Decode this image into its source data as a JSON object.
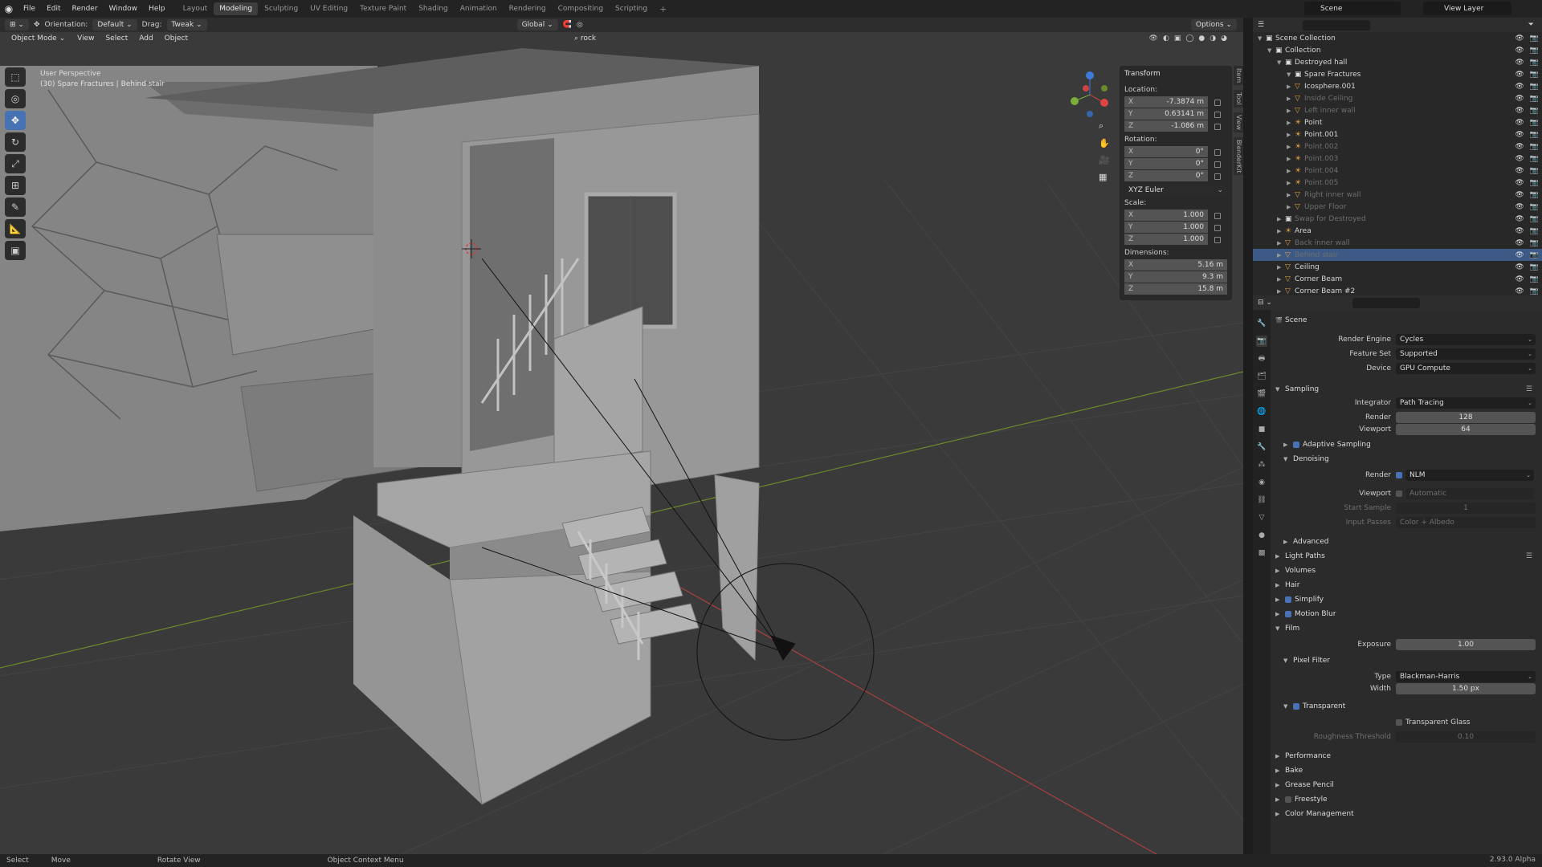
{
  "topbar": {
    "menus": [
      "File",
      "Edit",
      "Render",
      "Window",
      "Help"
    ],
    "workspaces": [
      "Layout",
      "Modeling",
      "Sculpting",
      "UV Editing",
      "Texture Paint",
      "Shading",
      "Animation",
      "Rendering",
      "Compositing",
      "Scripting"
    ],
    "active_workspace": "Modeling",
    "scene": "Scene",
    "view_layer": "View Layer"
  },
  "viewport_header": {
    "orientation_label": "Orientation:",
    "orientation_value": "Default",
    "drag_label": "Drag:",
    "drag_value": "Tweak",
    "transform_space": "Global",
    "search_value": "rock",
    "options_label": "Options"
  },
  "viewport_header2": {
    "mode": "Object Mode",
    "menus": [
      "View",
      "Select",
      "Add",
      "Object"
    ]
  },
  "viewport_info": {
    "line1": "User Perspective",
    "line2": "(30) Spare Fractures | Behind stair"
  },
  "npanel": {
    "title": "Transform",
    "location_label": "Location:",
    "location": {
      "x": "-7.3874 m",
      "y": "0.63141 m",
      "z": "-1.086 m"
    },
    "rotation_label": "Rotation:",
    "rotation": {
      "x": "0°",
      "y": "0°",
      "z": "0°"
    },
    "rotation_mode": "XYZ Euler",
    "scale_label": "Scale:",
    "scale": {
      "x": "1.000",
      "y": "1.000",
      "z": "1.000"
    },
    "dimensions_label": "Dimensions:",
    "dimensions": {
      "x": "5.16 m",
      "y": "9.3 m",
      "z": "15.8 m"
    },
    "tabs": [
      "Item",
      "Tool",
      "View",
      "BlenderKit"
    ]
  },
  "outliner": {
    "rows": [
      {
        "label": "Scene Collection",
        "indent": 0,
        "dim": false,
        "sel": false,
        "type": "coll"
      },
      {
        "label": "Collection",
        "indent": 1,
        "dim": false,
        "sel": false,
        "type": "coll"
      },
      {
        "label": "Destroyed hall",
        "indent": 2,
        "dim": false,
        "sel": false,
        "type": "coll"
      },
      {
        "label": "Spare Fractures",
        "indent": 3,
        "dim": false,
        "sel": false,
        "type": "coll"
      },
      {
        "label": "Icosphere.001",
        "indent": 3,
        "dim": false,
        "sel": false,
        "type": "mesh"
      },
      {
        "label": "Inside Ceiling",
        "indent": 3,
        "dim": true,
        "sel": false,
        "type": "mesh"
      },
      {
        "label": "Left inner wall",
        "indent": 3,
        "dim": true,
        "sel": false,
        "type": "mesh"
      },
      {
        "label": "Point",
        "indent": 3,
        "dim": false,
        "sel": false,
        "type": "light"
      },
      {
        "label": "Point.001",
        "indent": 3,
        "dim": false,
        "sel": false,
        "type": "light"
      },
      {
        "label": "Point.002",
        "indent": 3,
        "dim": true,
        "sel": false,
        "type": "light"
      },
      {
        "label": "Point.003",
        "indent": 3,
        "dim": true,
        "sel": false,
        "type": "light"
      },
      {
        "label": "Point.004",
        "indent": 3,
        "dim": true,
        "sel": false,
        "type": "light"
      },
      {
        "label": "Point.005",
        "indent": 3,
        "dim": true,
        "sel": false,
        "type": "light"
      },
      {
        "label": "Right inner wall",
        "indent": 3,
        "dim": true,
        "sel": false,
        "type": "mesh"
      },
      {
        "label": "Upper Floor",
        "indent": 3,
        "dim": true,
        "sel": false,
        "type": "mesh"
      },
      {
        "label": "Swap for Destroyed",
        "indent": 2,
        "dim": true,
        "sel": false,
        "type": "coll"
      },
      {
        "label": "Area",
        "indent": 2,
        "dim": false,
        "sel": false,
        "type": "light"
      },
      {
        "label": "Back inner wall",
        "indent": 2,
        "dim": true,
        "sel": false,
        "type": "mesh"
      },
      {
        "label": "Behind stair",
        "indent": 2,
        "dim": true,
        "sel": true,
        "type": "mesh"
      },
      {
        "label": "Ceiling",
        "indent": 2,
        "dim": false,
        "sel": false,
        "type": "mesh"
      },
      {
        "label": "Corner Beam",
        "indent": 2,
        "dim": false,
        "sel": false,
        "type": "mesh"
      },
      {
        "label": "Corner Beam #2",
        "indent": 2,
        "dim": false,
        "sel": false,
        "type": "mesh"
      }
    ]
  },
  "props": {
    "context": "Scene",
    "render_engine_label": "Render Engine",
    "render_engine": "Cycles",
    "feature_set_label": "Feature Set",
    "feature_set": "Supported",
    "device_label": "Device",
    "device": "GPU Compute",
    "sampling": "Sampling",
    "integrator_label": "Integrator",
    "integrator": "Path Tracing",
    "render_label": "Render",
    "render_samples": "128",
    "viewport_label": "Viewport",
    "viewport_samples": "64",
    "adaptive_sampling": "Adaptive Sampling",
    "denoising": "Denoising",
    "denoise_render_label": "Render",
    "denoise_render": "NLM",
    "denoise_viewport_label": "Viewport",
    "denoise_viewport": "Automatic",
    "start_sample_label": "Start Sample",
    "start_sample": "1",
    "input_passes_label": "Input Passes",
    "input_passes": "Color + Albedo",
    "advanced": "Advanced",
    "light_paths": "Light Paths",
    "volumes": "Volumes",
    "hair": "Hair",
    "simplify": "Simplify",
    "motion_blur": "Motion Blur",
    "film": "Film",
    "exposure_label": "Exposure",
    "exposure": "1.00",
    "pixel_filter": "Pixel Filter",
    "type_label": "Type",
    "type_value": "Blackman-Harris",
    "width_label": "Width",
    "width_value": "1.50 px",
    "transparent": "Transparent",
    "transparent_glass": "Transparent Glass",
    "roughness_label": "Roughness Threshold",
    "roughness_value": "0.10",
    "performance": "Performance",
    "bake": "Bake",
    "grease_pencil": "Grease Pencil",
    "freestyle": "Freestyle",
    "color_management": "Color Management"
  },
  "statusbar": {
    "items": [
      "Select",
      "Move",
      "Rotate View",
      "Object Context Menu"
    ],
    "version": "2.93.0 Alpha"
  }
}
